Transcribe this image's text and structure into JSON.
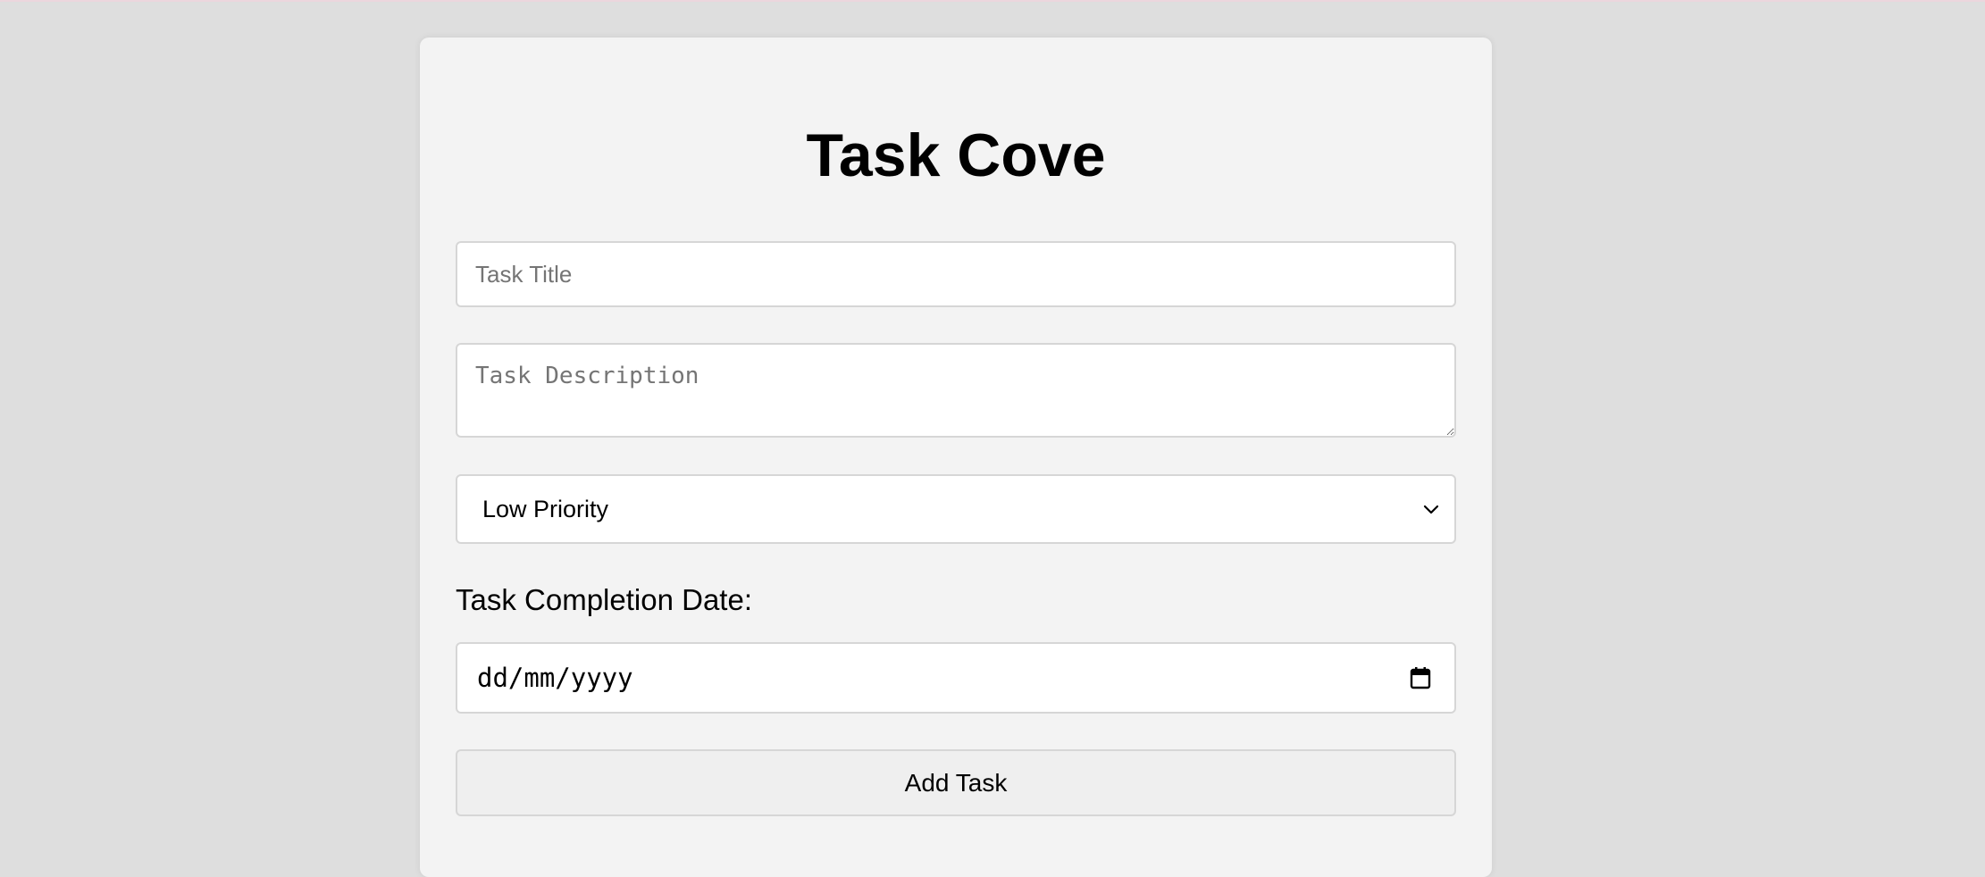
{
  "app": {
    "title": "Task Cove"
  },
  "form": {
    "title_input": {
      "placeholder": "Task Title",
      "value": ""
    },
    "description_input": {
      "placeholder": "Task Description",
      "value": ""
    },
    "priority_select": {
      "selected": "Low Priority",
      "icon": "chevron-down-icon"
    },
    "date_label": "Task Completion Date:",
    "date_input": {
      "value": "dd/mm/yyyy",
      "icon": "calendar-icon"
    },
    "add_button_label": "Add Task"
  },
  "colors": {
    "page_background": "#dedede",
    "card_background": "#f3f3f3",
    "field_background": "#ffffff",
    "field_border": "#d6d6d6",
    "button_background": "#efefef",
    "placeholder_text": "#757575"
  }
}
